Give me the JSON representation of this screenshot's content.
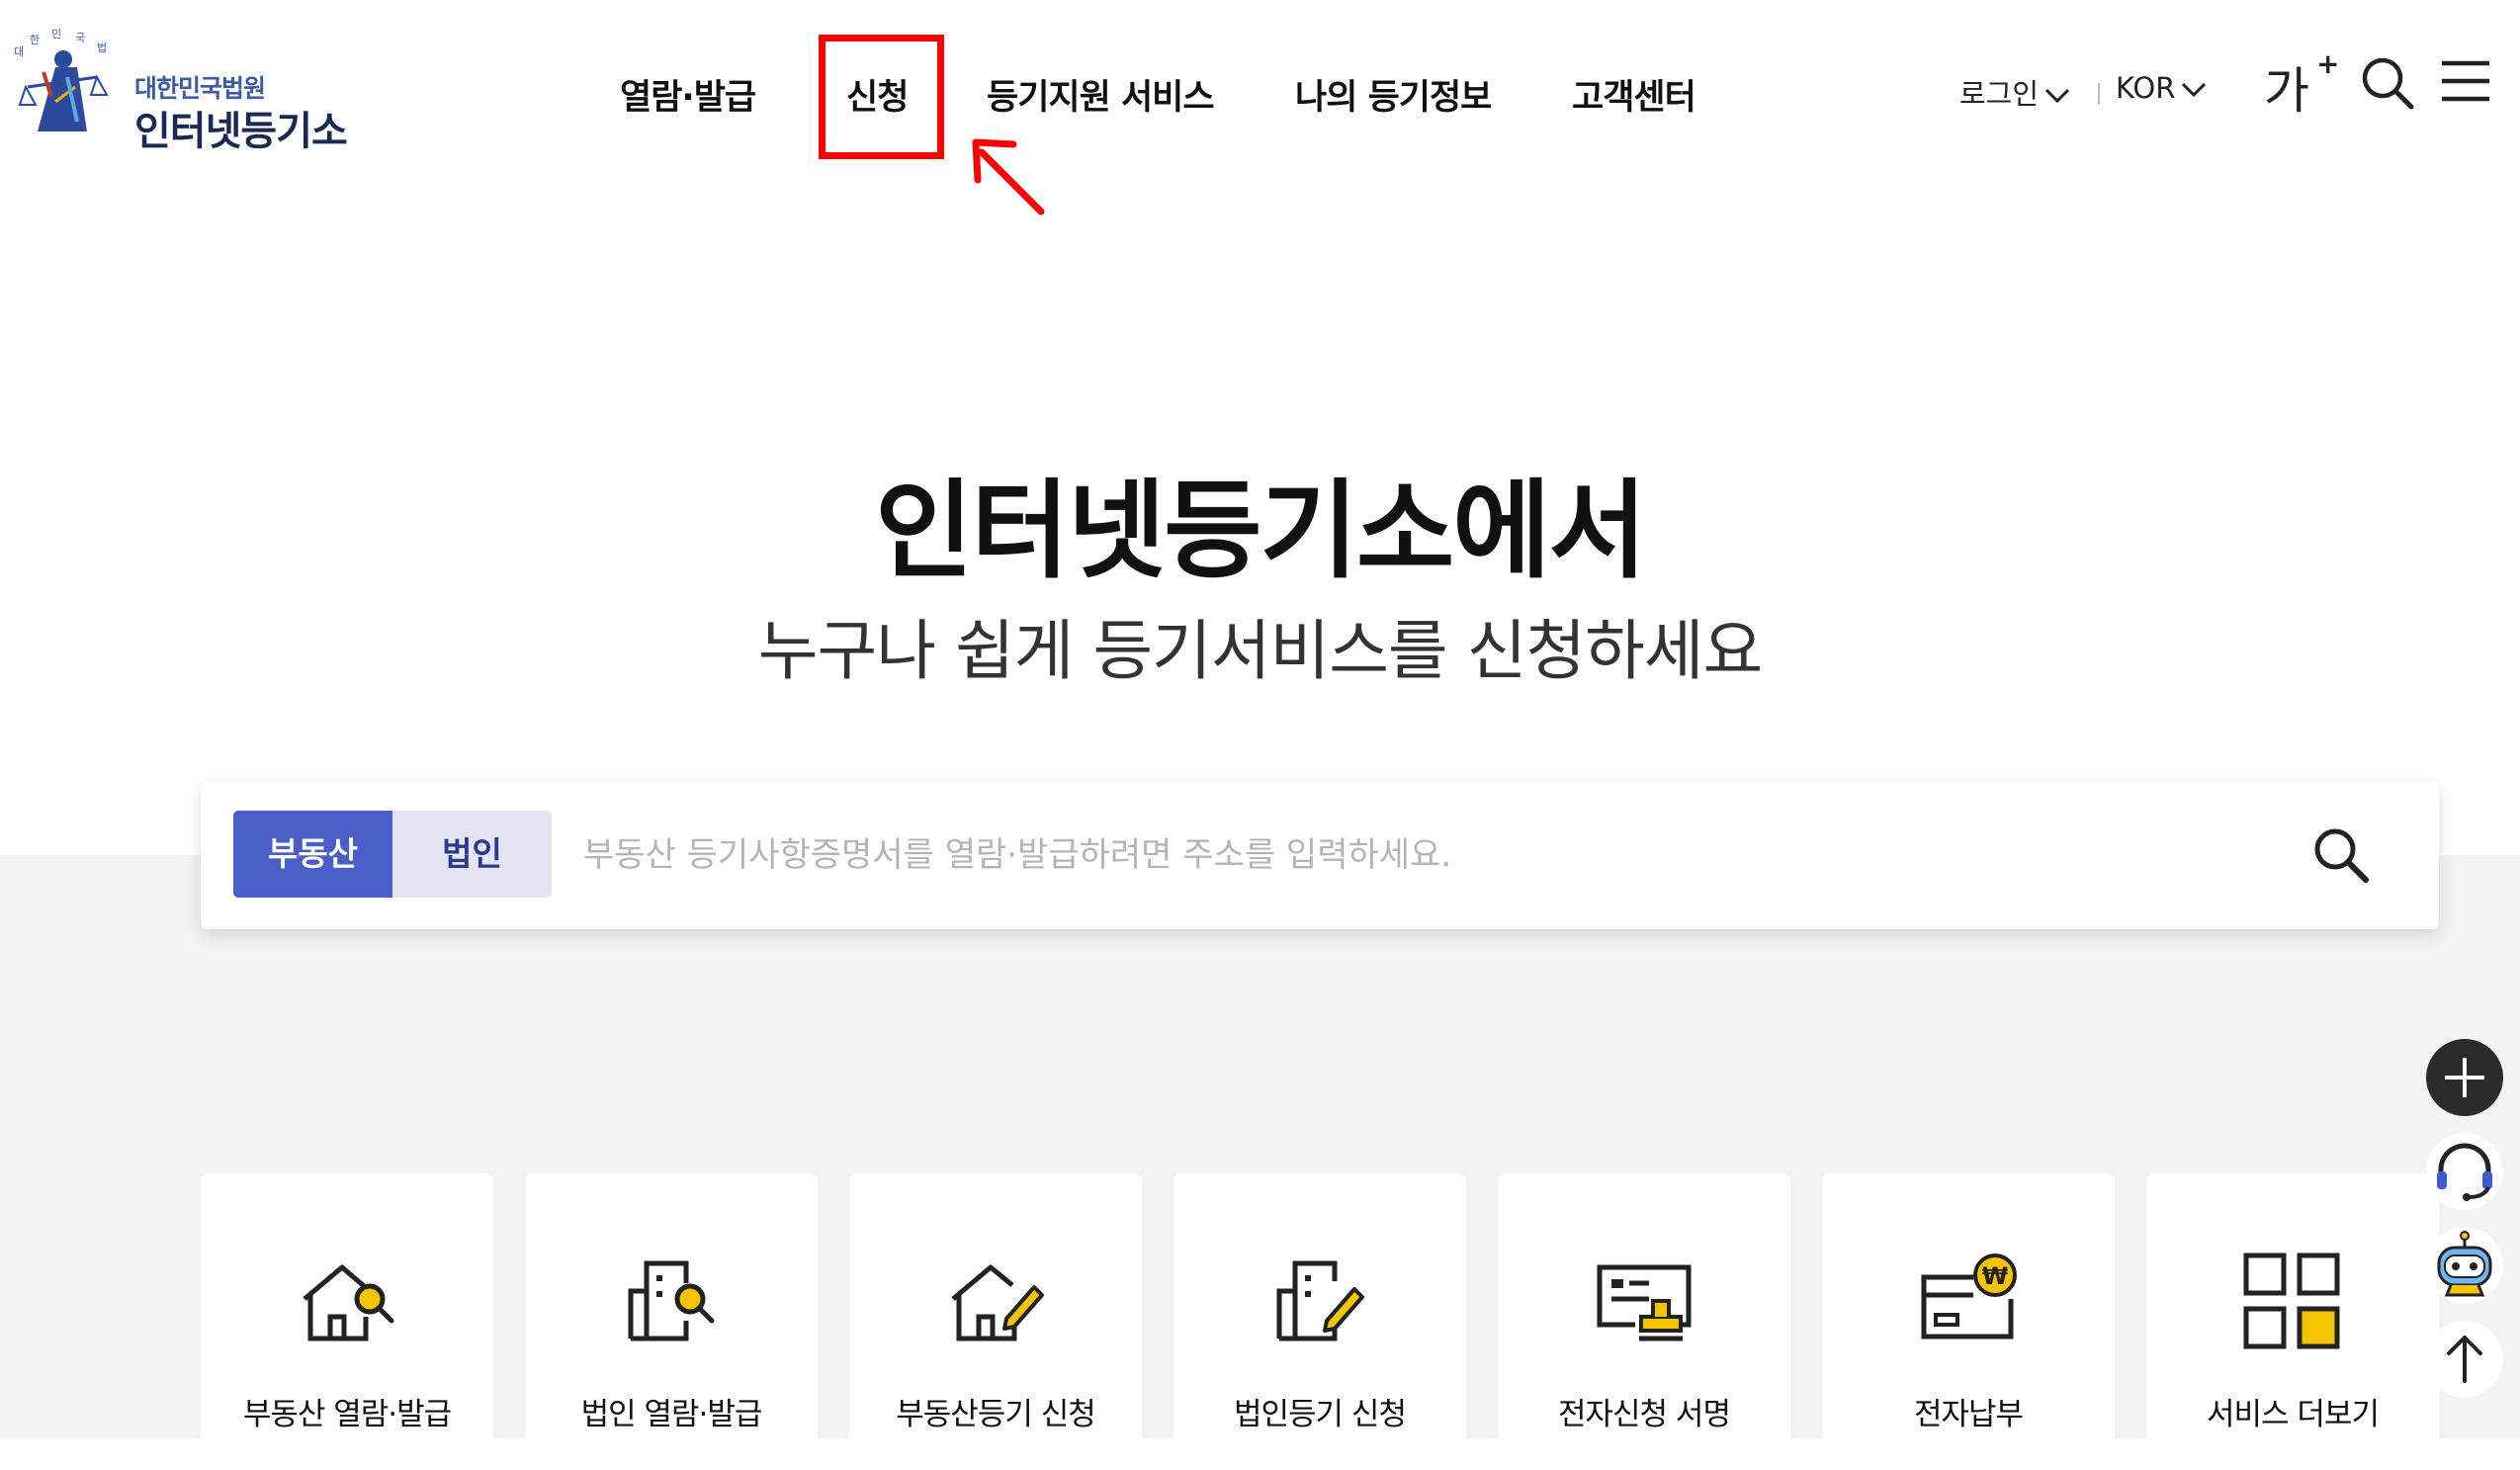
{
  "logo": {
    "small": "대한민국법원",
    "big": "인터넷등기소"
  },
  "nav": [
    {
      "label": "열람·발급"
    },
    {
      "label": "신청"
    },
    {
      "label": "등기지원 서비스"
    },
    {
      "label": "나의 등기정보"
    },
    {
      "label": "고객센터"
    }
  ],
  "utility": {
    "login": "로그인",
    "language": "KOR",
    "font_size": "가",
    "font_plus": "+"
  },
  "hero": {
    "title": "인터넷등기소에서",
    "subtitle": "누구나 쉽게 등기서비스를 신청하세요"
  },
  "search": {
    "tabs": [
      {
        "label": "부동산"
      },
      {
        "label": "법인"
      }
    ],
    "placeholder": "부동산 등기사항증명서를 열람·발급하려면 주소를 입력하세요."
  },
  "services": [
    {
      "label": "부동산 열람·발급",
      "icon": "house-search-icon"
    },
    {
      "label": "법인 열람·발급",
      "icon": "building-search-icon"
    },
    {
      "label": "부동산등기 신청",
      "icon": "house-pen-icon"
    },
    {
      "label": "법인등기 신청",
      "icon": "building-pen-icon"
    },
    {
      "label": "전자신청 서명",
      "icon": "document-stamp-icon"
    },
    {
      "label": "전자납부",
      "icon": "wallet-won-icon"
    },
    {
      "label": "서비스 더보기",
      "icon": "grid-more-icon"
    }
  ],
  "colors": {
    "accent": "#4a5ec7",
    "highlight": "#ff0000",
    "icon_yellow": "#f5c400",
    "dark": "#222222"
  }
}
